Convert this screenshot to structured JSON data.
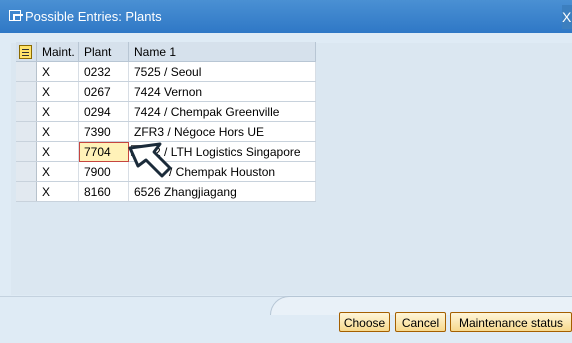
{
  "window": {
    "title": "Possible Entries: Plants",
    "close_label": "X"
  },
  "table": {
    "columns": [
      "Maint.",
      "Plant",
      "Name 1"
    ],
    "rows": [
      {
        "maint": "X",
        "plant": "0232",
        "name": "7525 / Seoul"
      },
      {
        "maint": "X",
        "plant": "0267",
        "name": "7424 Vernon"
      },
      {
        "maint": "X",
        "plant": "0294",
        "name": "7424 / Chempak Greenville"
      },
      {
        "maint": "X",
        "plant": "7390",
        "name": "ZFR3 / Négoce Hors UE"
      },
      {
        "maint": "X",
        "plant": "7704",
        "name": "6962 / LTH Logistics Singapore"
      },
      {
        "maint": "X",
        "plant": "7900",
        "name": "/ Chempak Houston"
      },
      {
        "maint": "X",
        "plant": "8160",
        "name": "6526 Zhangjiagang"
      }
    ]
  },
  "buttons": {
    "choose": "Choose",
    "cancel": "Cancel",
    "maintenance_status": "Maintenance status"
  }
}
